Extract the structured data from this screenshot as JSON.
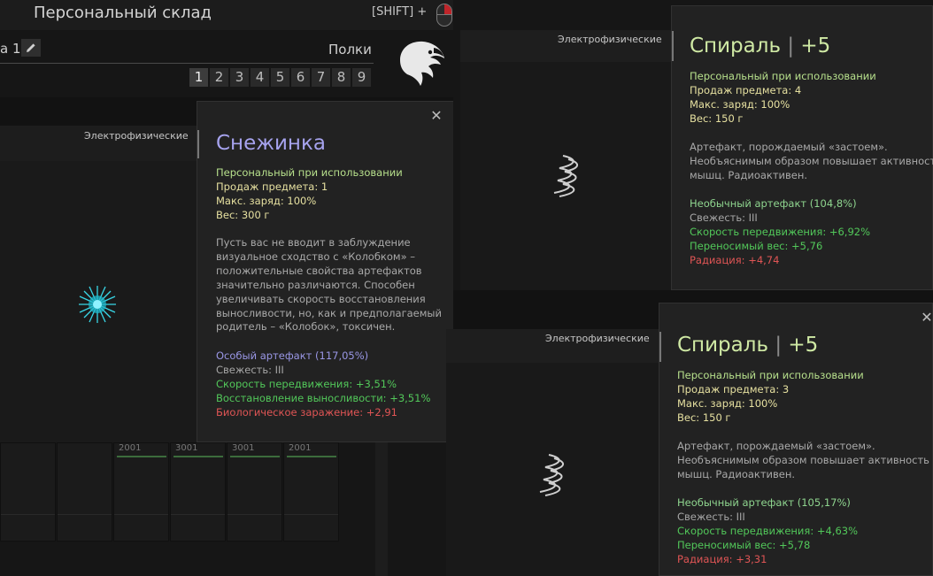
{
  "storage": {
    "title": "Персональный склад",
    "shift_hint": "[SHIFT] +",
    "tab_label": "а 1",
    "shelves_label": "Полки",
    "pages": [
      "1",
      "2",
      "3",
      "4",
      "5",
      "6",
      "7",
      "8",
      "9"
    ],
    "active_page": "1",
    "category": "Электрофизические",
    "cells": [
      "",
      "",
      "2001",
      "3001",
      "3001",
      "2001"
    ]
  },
  "tooltip_main": {
    "title": "Снежинка",
    "lines_top": [
      {
        "text": "Персональный при использовании",
        "cls": "c-green"
      },
      {
        "text": "Продаж предмета: 1",
        "cls": "c-yellow"
      },
      {
        "text": "Макс. заряд: 100%",
        "cls": "c-yellow"
      },
      {
        "text": "Вес: 300 г",
        "cls": "c-yellow"
      }
    ],
    "description": [
      "Пусть вас не вводит в заблуждение",
      "визуальное сходство с «Колобком» –",
      "положительные свойства артефактов",
      "значительно различаются. Способен",
      "увеличивать скорость восстановления",
      "выносливости, но, как и предполагаемый",
      "родитель – «Колобок», токсичен."
    ],
    "stats": [
      {
        "text": "Особый артефакт (117,05%)",
        "cls": "c-purple"
      },
      {
        "text": "Свежесть: III",
        "cls": "c-grey"
      },
      {
        "text": "Скорость передвижения: +3,51%",
        "cls": "c-stat"
      },
      {
        "text": "Восстановление выносливости: +3,51%",
        "cls": "c-stat"
      },
      {
        "text": "Биологическое заражение: +2,91",
        "cls": "c-neg"
      }
    ]
  },
  "tooltip_spiral_1": {
    "category": "Электрофизические",
    "title_name": "Спираль",
    "title_sep": "|",
    "title_level": "+5",
    "lines_top": [
      {
        "text": "Персональный при использовании",
        "cls": "c-green"
      },
      {
        "text": "Продаж предмета: 4",
        "cls": "c-yellow"
      },
      {
        "text": "Макс. заряд: 100%",
        "cls": "c-yellow"
      },
      {
        "text": "Вес: 150 г",
        "cls": "c-yellow"
      }
    ],
    "description": [
      "Артефакт, порождаемый «застоем».",
      "Необъяснимым образом повышает активность",
      "мышц. Радиоактивен."
    ],
    "stats": [
      {
        "text": "Необычный артефакт (104,8%)",
        "cls": "c-lgreen"
      },
      {
        "text": "Свежесть: III",
        "cls": "c-grey"
      },
      {
        "text": "Скорость передвижения: +6,92%",
        "cls": "c-stat"
      },
      {
        "text": "Переносимый вес: +5,76",
        "cls": "c-stat"
      },
      {
        "text": "Радиация: +4,74",
        "cls": "c-neg"
      }
    ]
  },
  "tooltip_spiral_2": {
    "category": "Электрофизические",
    "title_name": "Спираль",
    "title_sep": "|",
    "title_level": "+5",
    "lines_top": [
      {
        "text": "Персональный при использовании",
        "cls": "c-green"
      },
      {
        "text": "Продаж предмета: 3",
        "cls": "c-yellow"
      },
      {
        "text": "Макс. заряд: 100%",
        "cls": "c-yellow"
      },
      {
        "text": "Вес: 150 г",
        "cls": "c-yellow"
      }
    ],
    "description": [
      "Артефакт, порождаемый «застоем».",
      "Необъяснимым образом повышает активность",
      "мышц. Радиоактивен."
    ],
    "stats": [
      {
        "text": "Необычный артефакт (105,17%)",
        "cls": "c-lgreen"
      },
      {
        "text": "Свежесть: III",
        "cls": "c-grey"
      },
      {
        "text": "Скорость передвижения: +4,63%",
        "cls": "c-stat"
      },
      {
        "text": "Переносимый вес: +5,78",
        "cls": "c-stat"
      },
      {
        "text": "Радиация: +3,31",
        "cls": "c-neg"
      }
    ]
  },
  "icons": {
    "close": "close-icon",
    "edit": "pencil-icon",
    "mouse": "mouse-icon",
    "logo": "eagle-logo-icon",
    "artifact_snowflake": "snowflake-artifact-icon",
    "artifact_spiral": "spiral-artifact-icon"
  },
  "colors": {
    "uncommon": "#8fd58f",
    "special": "#9a97e6",
    "positive": "#52c85a",
    "negative": "#e05555",
    "weight": "#e6e0a0"
  }
}
